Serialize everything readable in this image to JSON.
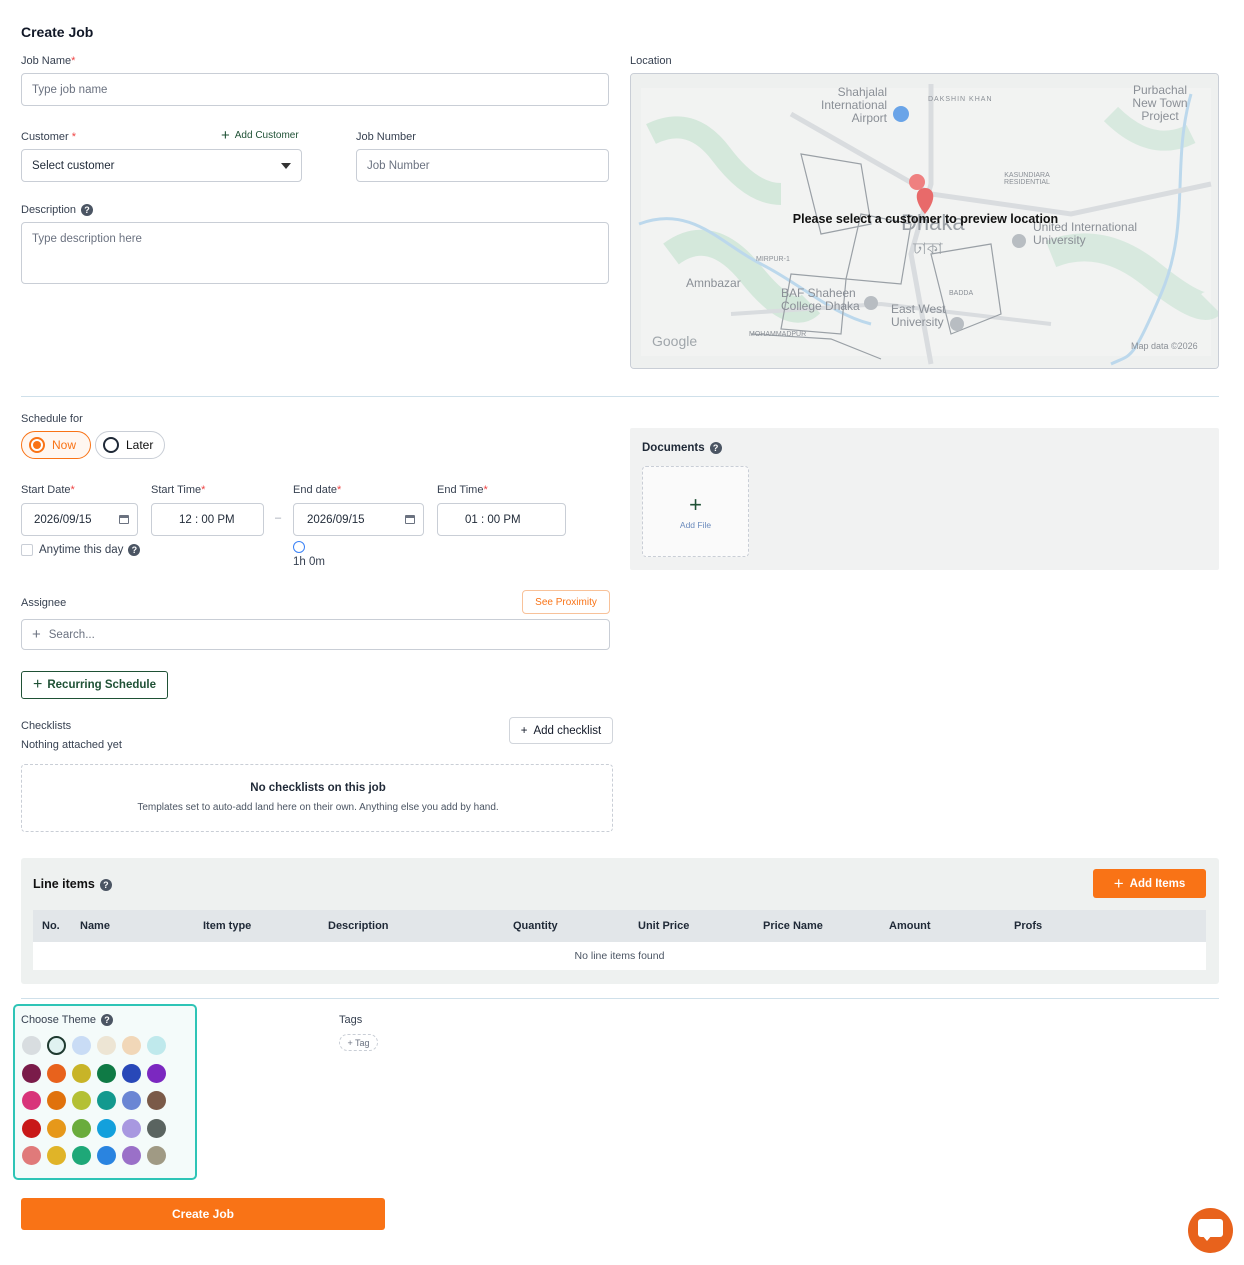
{
  "page": {
    "title": "Create Job"
  },
  "job_name": {
    "label": "Job Name",
    "required": "*",
    "placeholder": "Type job name"
  },
  "customer": {
    "label": "Customer",
    "required": "*",
    "add_label": "Add Customer",
    "placeholder": "Select customer"
  },
  "job_number": {
    "label": "Job Number",
    "placeholder": "Job Number"
  },
  "description": {
    "label": "Description",
    "placeholder": "Type description here"
  },
  "location": {
    "label": "Location",
    "overlay_text": "Please select a customer to preview location",
    "map_labels": {
      "airport": "Shahjalal International Airport",
      "dakshin_khan": "DAKSHIN KHAN",
      "purbachal": "Purbachal New Town Project",
      "dhaka": "Dhaka",
      "dhaka_bn": "ঢাকা",
      "amnbazar": "Amnbazar",
      "baf": "BAF Shaheen College Dhaka",
      "eastwest": "East West University",
      "uiu": "United International University",
      "mirpur": "MIRPUR-1",
      "mohammadpur": "MOHAMMADPUR",
      "badda": "BADDA",
      "kasundiara": "KASUNDIARA RESIDENTIAL",
      "google": "Google",
      "attribution": "Map data ©2026"
    }
  },
  "schedule": {
    "label": "Schedule for",
    "options": [
      "Now",
      "Later"
    ],
    "selected": "Now",
    "start_date": {
      "label": "Start Date",
      "value": "2026/09/15"
    },
    "start_time": {
      "label": "Start Time",
      "value": "12 : 00 PM"
    },
    "end_date": {
      "label": "End date",
      "value": "2026/09/15"
    },
    "end_time": {
      "label": "End Time",
      "value": "01 : 00 PM"
    },
    "separator": "–",
    "duration": "1h 0m",
    "anytime_label": "Anytime this day"
  },
  "documents": {
    "title": "Documents",
    "add_file": "Add File"
  },
  "assignee": {
    "label": "Assignee",
    "proximity_button": "See Proximity",
    "search_placeholder": "Search..."
  },
  "recurring_button": "Recurring Schedule",
  "checklists": {
    "label": "Checklists",
    "status": "Nothing attached yet",
    "add_button": "Add checklist",
    "empty_title": "No checklists on this job",
    "empty_text": "Templates set to auto-add land here on their own. Anything else you add by hand."
  },
  "line_items": {
    "title": "Line items",
    "add_button": "Add Items",
    "columns": [
      "No.",
      "Name",
      "Item type",
      "Description",
      "Quantity",
      "Unit Price",
      "Price Name",
      "Amount",
      "Profs"
    ],
    "empty": "No line items found"
  },
  "theme": {
    "label": "Choose Theme",
    "colors": [
      [
        "#d8dde0",
        "#e0f2f1",
        "#c9dcf5",
        "#ede5d4",
        "#f1d7b8",
        "#bfe9ec"
      ],
      [
        "#7a1c4a",
        "#e8621c",
        "#c8b428",
        "#0f7a45",
        "#2848b8",
        "#7b28c0"
      ],
      [
        "#d8347a",
        "#e0720c",
        "#b4c034",
        "#13998e",
        "#6a86d4",
        "#7a5a48"
      ],
      [
        "#c81818",
        "#e6981a",
        "#6aac3c",
        "#13a0dc",
        "#a898e0",
        "#5a6460"
      ],
      [
        "#e07a7a",
        "#e0b428",
        "#1ea878",
        "#2a84e0",
        "#9a70c8",
        "#a09a84"
      ]
    ]
  },
  "tags": {
    "label": "Tags",
    "add_label": "+ Tag"
  },
  "submit_button": "Create Job",
  "colors": {
    "accent": "#f97316",
    "teal": "#2ec4b6",
    "dark_green": "#1f5135"
  }
}
